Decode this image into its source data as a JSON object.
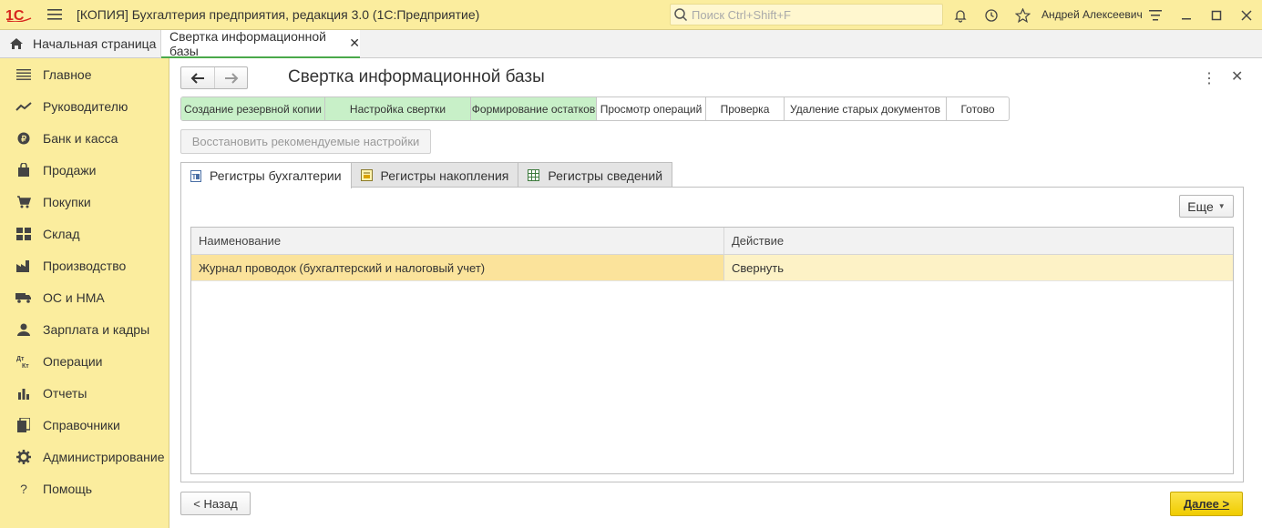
{
  "app": {
    "title": "[КОПИЯ] Бухгалтерия предприятия, редакция 3.0  (1С:Предприятие)",
    "search_placeholder": "Поиск Ctrl+Shift+F",
    "user": "Андрей Алексеевич"
  },
  "tabs": {
    "home": "Начальная страница",
    "current": "Свертка информационной базы"
  },
  "sidebar": {
    "items": [
      {
        "label": "Главное",
        "icon": "menu-lines-icon"
      },
      {
        "label": "Руководителю",
        "icon": "trend-icon"
      },
      {
        "label": "Банк и касса",
        "icon": "ruble-coin-icon"
      },
      {
        "label": "Продажи",
        "icon": "bag-icon"
      },
      {
        "label": "Покупки",
        "icon": "cart-icon"
      },
      {
        "label": "Склад",
        "icon": "warehouse-icon"
      },
      {
        "label": "Производство",
        "icon": "factory-icon"
      },
      {
        "label": "ОС и НМА",
        "icon": "truck-icon"
      },
      {
        "label": "Зарплата и кадры",
        "icon": "person-icon"
      },
      {
        "label": "Операции",
        "icon": "dt-kt-icon"
      },
      {
        "label": "Отчеты",
        "icon": "bar-chart-icon"
      },
      {
        "label": "Справочники",
        "icon": "books-icon"
      },
      {
        "label": "Администрирование",
        "icon": "gear-icon"
      },
      {
        "label": "Помощь",
        "icon": "question-icon"
      }
    ]
  },
  "form": {
    "title": "Свертка информационной базы",
    "restore_button": "Восстановить рекомендуемые настройки",
    "more_button": "Еще",
    "back_button": "< Назад",
    "next_button": "Далее >"
  },
  "steps": [
    {
      "label": "Создание резервной копии",
      "done": true
    },
    {
      "label": "Настройка свертки",
      "done": true
    },
    {
      "label": "Формирование остатков",
      "done": true
    },
    {
      "label": "Просмотр операций",
      "done": false
    },
    {
      "label": "Проверка",
      "done": false
    },
    {
      "label": "Удаление старых документов",
      "done": false
    },
    {
      "label": "Готово",
      "done": false
    }
  ],
  "register_tabs": [
    {
      "label": "Регистры бухгалтерии",
      "active": true
    },
    {
      "label": "Регистры накопления",
      "active": false
    },
    {
      "label": "Регистры сведений",
      "active": false
    }
  ],
  "table": {
    "columns": [
      "Наименование",
      "Действие"
    ],
    "rows": [
      [
        "Журнал проводок (бухгалтерский и налоговый учет)",
        "Свернуть"
      ]
    ]
  },
  "colors": {
    "titlebar": "#fbed9e",
    "step_done": "#c8f0c8",
    "next_button": "#f0cc00",
    "active_tab_underline": "#4aa94a"
  }
}
